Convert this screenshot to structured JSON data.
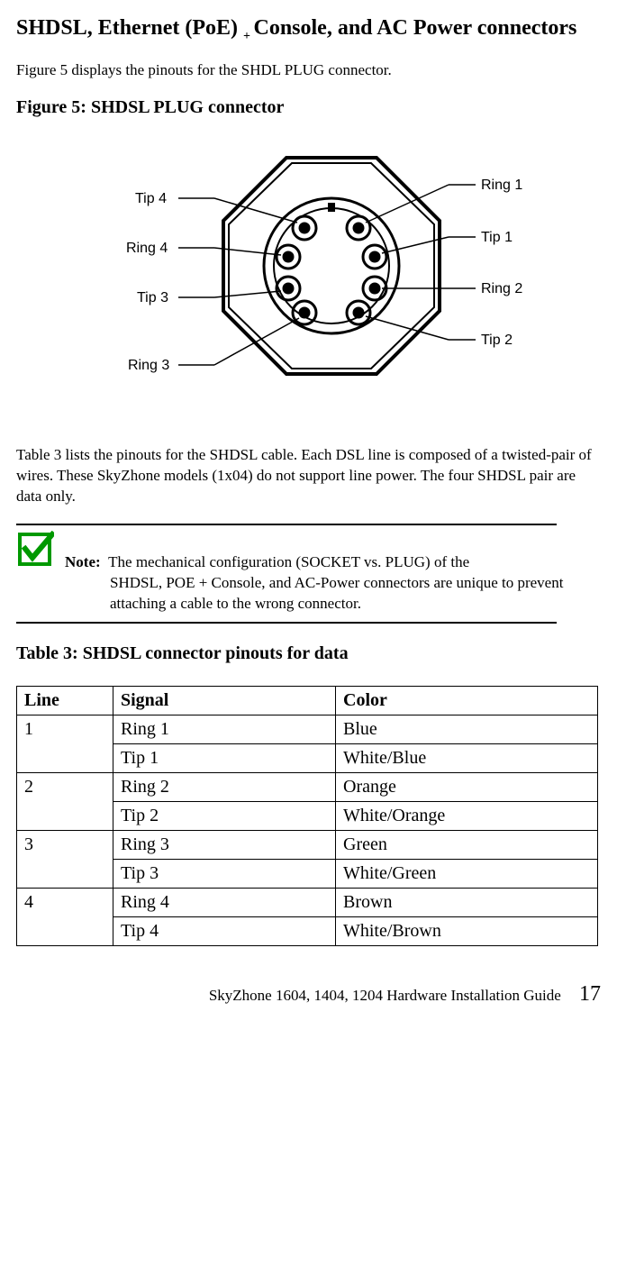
{
  "heading_main": "SHDSL, Ethernet (PoE) + Console, and AC Power connectors",
  "para1": "Figure 5 displays the pinouts for the SHDL PLUG connector.",
  "figure_caption": "Figure 5: SHDSL PLUG connector",
  "diagram_labels": {
    "tip4": "Tip 4",
    "ring4": "Ring 4",
    "tip3": "Tip 3",
    "ring3": "Ring 3",
    "ring1": "Ring 1",
    "tip1": "Tip 1",
    "ring2": "Ring 2",
    "tip2": "Tip 2"
  },
  "para2": "Table 3 lists the pinouts for the SHDSL cable. Each DSL line is composed of a twisted-pair of wires. These SkyZhone models (1x04) do not support line power. The four SHDSL pair are data only.",
  "note_label": "Note:",
  "note_line1": "The mechanical configuration (SOCKET vs. PLUG) of the",
  "note_rest": "SHDSL, POE + Console, and AC-Power connectors are unique to prevent attaching a cable to the wrong connector.",
  "table_caption": "Table 3: SHDSL connector pinouts for data",
  "table": {
    "headers": [
      "Line",
      "Signal",
      "Color"
    ],
    "rows": [
      {
        "line": "1",
        "signal": "Ring 1",
        "color": "Blue"
      },
      {
        "line": "",
        "signal": "Tip 1",
        "color": "White/Blue"
      },
      {
        "line": "2",
        "signal": "Ring 2",
        "color": "Orange"
      },
      {
        "line": "",
        "signal": "Tip 2",
        "color": "White/Orange"
      },
      {
        "line": "3",
        "signal": "Ring 3",
        "color": "Green"
      },
      {
        "line": "",
        "signal": "Tip 3",
        "color": "White/Green"
      },
      {
        "line": "4",
        "signal": "Ring 4",
        "color": "Brown"
      },
      {
        "line": "",
        "signal": "Tip 4",
        "color": "White/Brown"
      }
    ]
  },
  "footer_text": "SkyZhone 1604, 1404, 1204 Hardware Installation Guide",
  "page_number": "17"
}
